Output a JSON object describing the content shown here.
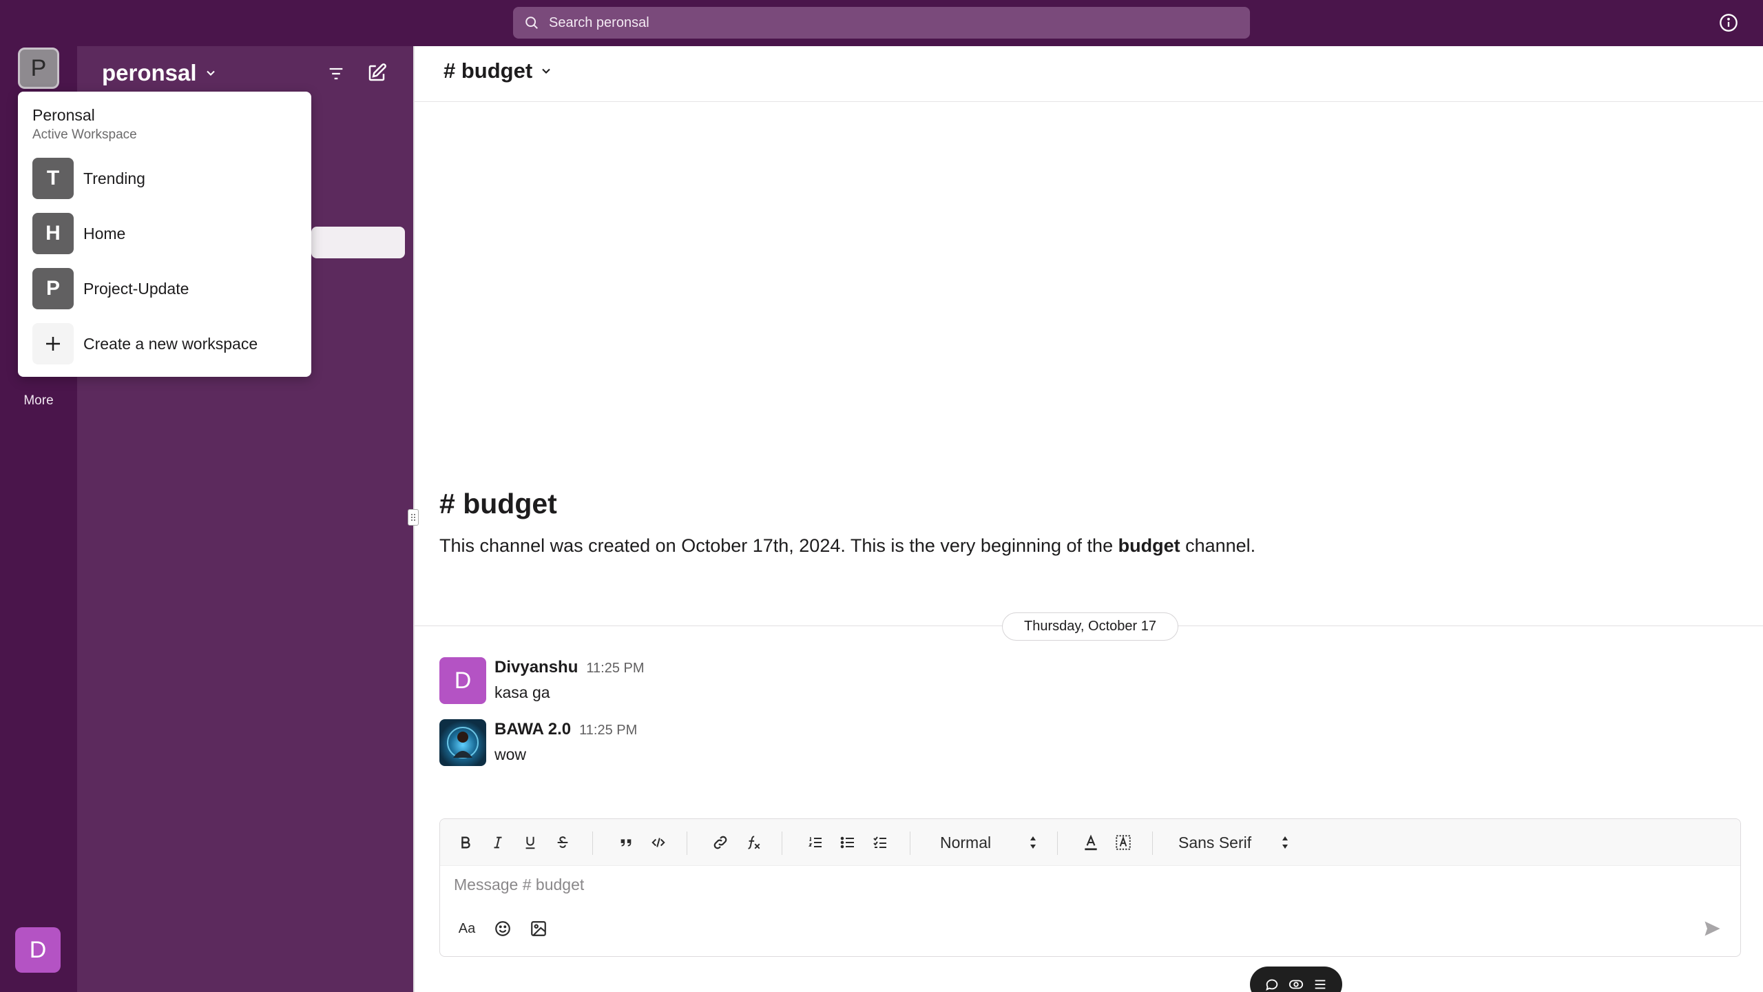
{
  "topbar": {
    "search_placeholder": "Search peronsal"
  },
  "rail": {
    "workspace_letter": "P",
    "more_label": "More",
    "user_letter": "D"
  },
  "sidebar": {
    "workspace_name": "peronsal"
  },
  "workspace_menu": {
    "title": "Peronsal",
    "subtitle": "Active Workspace",
    "items": [
      {
        "letter": "T",
        "label": "Trending"
      },
      {
        "letter": "H",
        "label": "Home"
      },
      {
        "letter": "P",
        "label": "Project-Update"
      }
    ],
    "create_label": "Create a new workspace"
  },
  "channel": {
    "header_title": "# budget",
    "intro_title": "# budget",
    "intro_prefix": "This channel was created on October 17th, 2024. This is the very beginning of the ",
    "intro_channel": "budget",
    "intro_suffix": " channel.",
    "date_divider": "Thursday, October 17"
  },
  "messages": [
    {
      "avatar_letter": "D",
      "avatar_color": "#b453c4",
      "author": "Divyanshu",
      "time": "11:25 PM",
      "text": "kasa ga"
    },
    {
      "avatar_letter": "",
      "avatar_color": "#1b4f6b",
      "author": "BAWA 2.0",
      "time": "11:25 PM",
      "text": "wow"
    }
  ],
  "composer": {
    "text_style": "Normal",
    "font": "Sans Serif",
    "placeholder": "Message # budget",
    "format_button": "Aa"
  },
  "colors": {
    "aubergine": "#4a154b",
    "sidebar": "#5c2a5d",
    "accent_purple": "#b453c4"
  }
}
